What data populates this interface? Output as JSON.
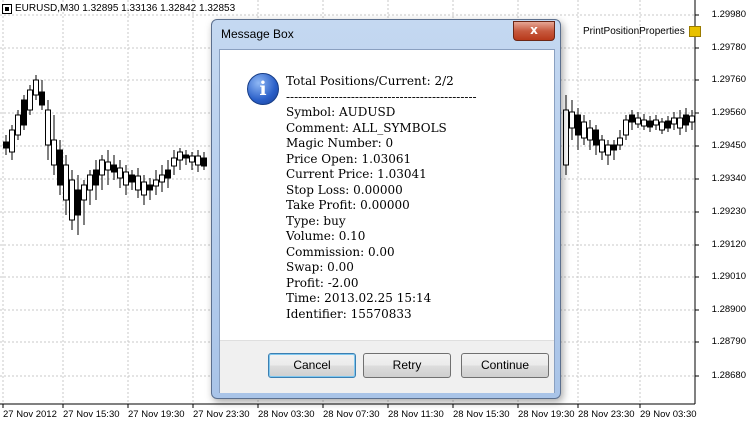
{
  "chart": {
    "header": "EURUSD,M30  1.32895 1.33136 1.32842 1.32853",
    "expert_label": "PrintPositionProperties",
    "price_labels": [
      "1.29980",
      "1.29780",
      "1.29760",
      "1.29560",
      "1.29450",
      "1.29340",
      "1.29230",
      "1.29120",
      "1.29010",
      "1.28900",
      "1.28790",
      "1.28680"
    ],
    "time_labels": [
      "27 Nov 2012",
      "27 Nov 15:30",
      "27 Nov 19:30",
      "27 Nov 23:30",
      "28 Nov 03:30",
      "28 Nov 07:30",
      "28 Nov 11:30",
      "28 Nov 15:30",
      "28 Nov 19:30",
      "28 Nov 23:30",
      "29 Nov 03:30"
    ],
    "colors": {
      "grid": "#c8c8c8",
      "candle": "#000000",
      "background": "#ffffff"
    }
  },
  "dialog": {
    "title": "Message Box",
    "close_glyph": "x",
    "icon": "info-icon",
    "message_lines": [
      "Total Positions/Current: 2/2",
      "-----------------------------------------------",
      "Symbol: AUDUSD",
      "Comment: ALL_SYMBOLS",
      "Magic Number: 0",
      "Price Open: 1.03061",
      "Current Price: 1.03041",
      "Stop Loss: 0.00000",
      "Take Profit: 0.00000",
      "Type: buy",
      "Volume: 0.10",
      "Commission: 0.00",
      "Swap: 0.00",
      "Profit: -2.00",
      "Time: 2013.02.25 15:14",
      "Identifier: 15570833"
    ],
    "buttons": {
      "cancel": "Cancel",
      "retry": "Retry",
      "continue": "Continue"
    }
  }
}
